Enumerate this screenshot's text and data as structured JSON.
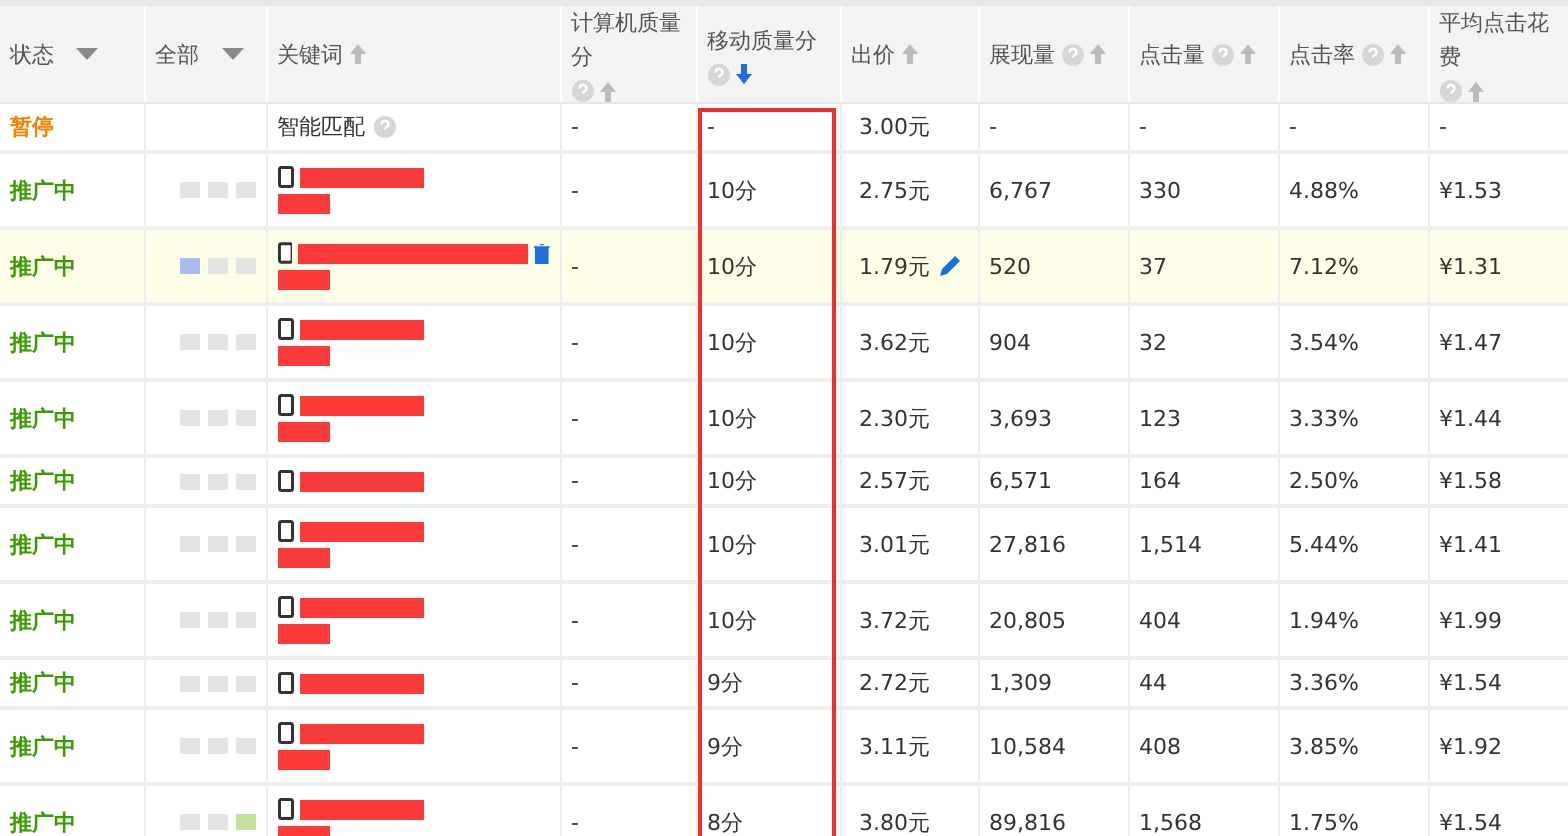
{
  "columns": [
    {
      "label": "状态",
      "kind": "filter",
      "help": false,
      "framed": false
    },
    {
      "label": "全部",
      "kind": "filter",
      "help": false,
      "framed": false
    },
    {
      "label": "关键词",
      "kind": "sortable",
      "help": false,
      "framed": false,
      "active_sort": false
    },
    {
      "label": "计算机质量分",
      "kind": "sortable",
      "help": true,
      "framed": false,
      "active_sort": false
    },
    {
      "label": "移动质量分",
      "kind": "sortable",
      "help": true,
      "framed": true,
      "active_sort": true
    },
    {
      "label": "出价",
      "kind": "sortable",
      "help": false,
      "framed": false,
      "active_sort": false
    },
    {
      "label": "展现量",
      "kind": "sortable",
      "help": true,
      "framed": false,
      "active_sort": false
    },
    {
      "label": "点击量",
      "kind": "sortable",
      "help": true,
      "framed": false,
      "active_sort": false
    },
    {
      "label": "点击率",
      "kind": "sortable",
      "help": true,
      "framed": false,
      "active_sort": false
    },
    {
      "label": "平均点击花费",
      "kind": "sortable",
      "help": true,
      "framed": false,
      "active_sort": false
    }
  ],
  "rows": [
    {
      "kind": "smart",
      "status": "暂停",
      "paused": true,
      "selected": false,
      "keyword": "智能匹配",
      "cells": [
        "-",
        "-",
        "3.00元",
        "-",
        "-",
        "-",
        "-"
      ]
    },
    {
      "kind": "keyword",
      "status": "推广中",
      "paused": false,
      "selected": false,
      "wrapped": true,
      "marks": [
        {
          "color": "#e4e4e4"
        },
        {
          "color": "#e4e4e4"
        },
        {
          "color": "#e4e4e4"
        }
      ],
      "cells": [
        "-",
        "10分",
        "2.75元",
        "6,767",
        "330",
        "4.88%",
        "¥1.53"
      ]
    },
    {
      "kind": "keyword",
      "status": "推广中",
      "paused": false,
      "selected": true,
      "wrapped": true,
      "marks": [
        {
          "color": "#a8bcf0"
        },
        {
          "color": "#e4e4e4"
        },
        {
          "color": "#e4e4e4"
        }
      ],
      "cells": [
        "-",
        "10分",
        "1.79元",
        "520",
        "37",
        "7.12%",
        "¥1.31"
      ]
    },
    {
      "kind": "keyword",
      "status": "推广中",
      "paused": false,
      "selected": false,
      "wrapped": true,
      "marks": [
        {
          "color": "#e4e4e4"
        },
        {
          "color": "#e4e4e4"
        },
        {
          "color": "#e4e4e4"
        }
      ],
      "cells": [
        "-",
        "10分",
        "3.62元",
        "904",
        "32",
        "3.54%",
        "¥1.47"
      ]
    },
    {
      "kind": "keyword",
      "status": "推广中",
      "paused": false,
      "selected": false,
      "wrapped": true,
      "marks": [
        {
          "color": "#e4e4e4"
        },
        {
          "color": "#e4e4e4"
        },
        {
          "color": "#e4e4e4"
        }
      ],
      "cells": [
        "-",
        "10分",
        "2.30元",
        "3,693",
        "123",
        "3.33%",
        "¥1.44"
      ]
    },
    {
      "kind": "keyword",
      "status": "推广中",
      "paused": false,
      "selected": false,
      "wrapped": false,
      "marks": [
        {
          "color": "#e4e4e4"
        },
        {
          "color": "#e4e4e4"
        },
        {
          "color": "#e4e4e4"
        }
      ],
      "cells": [
        "-",
        "10分",
        "2.57元",
        "6,571",
        "164",
        "2.50%",
        "¥1.58"
      ]
    },
    {
      "kind": "keyword",
      "status": "推广中",
      "paused": false,
      "selected": false,
      "wrapped": true,
      "marks": [
        {
          "color": "#e4e4e4"
        },
        {
          "color": "#e4e4e4"
        },
        {
          "color": "#e4e4e4"
        }
      ],
      "cells": [
        "-",
        "10分",
        "3.01元",
        "27,816",
        "1,514",
        "5.44%",
        "¥1.41"
      ]
    },
    {
      "kind": "keyword",
      "status": "推广中",
      "paused": false,
      "selected": false,
      "wrapped": true,
      "marks": [
        {
          "color": "#e4e4e4"
        },
        {
          "color": "#e4e4e4"
        },
        {
          "color": "#e4e4e4"
        }
      ],
      "cells": [
        "-",
        "10分",
        "3.72元",
        "20,805",
        "404",
        "1.94%",
        "¥1.99"
      ]
    },
    {
      "kind": "keyword",
      "status": "推广中",
      "paused": false,
      "selected": false,
      "wrapped": false,
      "marks": [
        {
          "color": "#e4e4e4"
        },
        {
          "color": "#e4e4e4"
        },
        {
          "color": "#e4e4e4"
        }
      ],
      "cells": [
        "-",
        "9分",
        "2.72元",
        "1,309",
        "44",
        "3.36%",
        "¥1.54"
      ]
    },
    {
      "kind": "keyword",
      "status": "推广中",
      "paused": false,
      "selected": false,
      "wrapped": true,
      "marks": [
        {
          "color": "#e4e4e4"
        },
        {
          "color": "#e4e4e4"
        },
        {
          "color": "#e4e4e4"
        }
      ],
      "cells": [
        "-",
        "9分",
        "3.11元",
        "10,584",
        "408",
        "3.85%",
        "¥1.92"
      ]
    },
    {
      "kind": "keyword",
      "status": "推广中",
      "paused": false,
      "selected": false,
      "wrapped": true,
      "marks": [
        {
          "color": "#e4e4e4"
        },
        {
          "color": "#e4e4e4"
        },
        {
          "color": "#c6e29a"
        }
      ],
      "cells": [
        "-",
        "8分",
        "3.80元",
        "89,816",
        "1,568",
        "1.75%",
        "¥1.54"
      ]
    }
  ]
}
